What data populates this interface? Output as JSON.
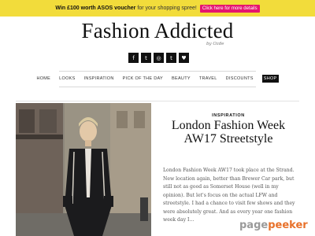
{
  "promo": {
    "lead": "Win £100 worth ASOS voucher",
    "rest": "for your shopping spree!",
    "cta": "Click here for more details",
    "colors": {
      "background": "#f2dc3b",
      "cta": "#e5156e"
    }
  },
  "header": {
    "logo": "Fashion Addicted",
    "tagline": "by Ozde"
  },
  "social": [
    {
      "icon": "facebook-icon",
      "glyph": "f"
    },
    {
      "icon": "twitter-icon",
      "glyph": "t"
    },
    {
      "icon": "instagram-icon",
      "glyph": "◎"
    },
    {
      "icon": "tumblr-icon",
      "glyph": "t"
    },
    {
      "icon": "heart-icon",
      "glyph": "♥"
    }
  ],
  "nav": {
    "items": [
      "HOME",
      "LOOKS",
      "INSPIRATION",
      "PICK OF THE DAY",
      "BEAUTY",
      "TRAVEL",
      "DISCOUNTS",
      "SHOP"
    ],
    "active": "SHOP"
  },
  "post": {
    "category": "INSPIRATION",
    "title": "London Fashion Week AW17 Streetstyle",
    "excerpt": "London Fashion Week AW17 took place at the Strand. New location again, better than Brewer Car park, but still not as good as Somerset House (well in my opinion). But let's focus on the actual LFW and streetstyle. I had a chance to visit few shows and they were absolutely great. And as every year one fashion week day I…",
    "image_alt": "Street style photo of a man in a black jacket on a city street"
  },
  "watermark": {
    "part1": "page",
    "part2": "peeker"
  }
}
